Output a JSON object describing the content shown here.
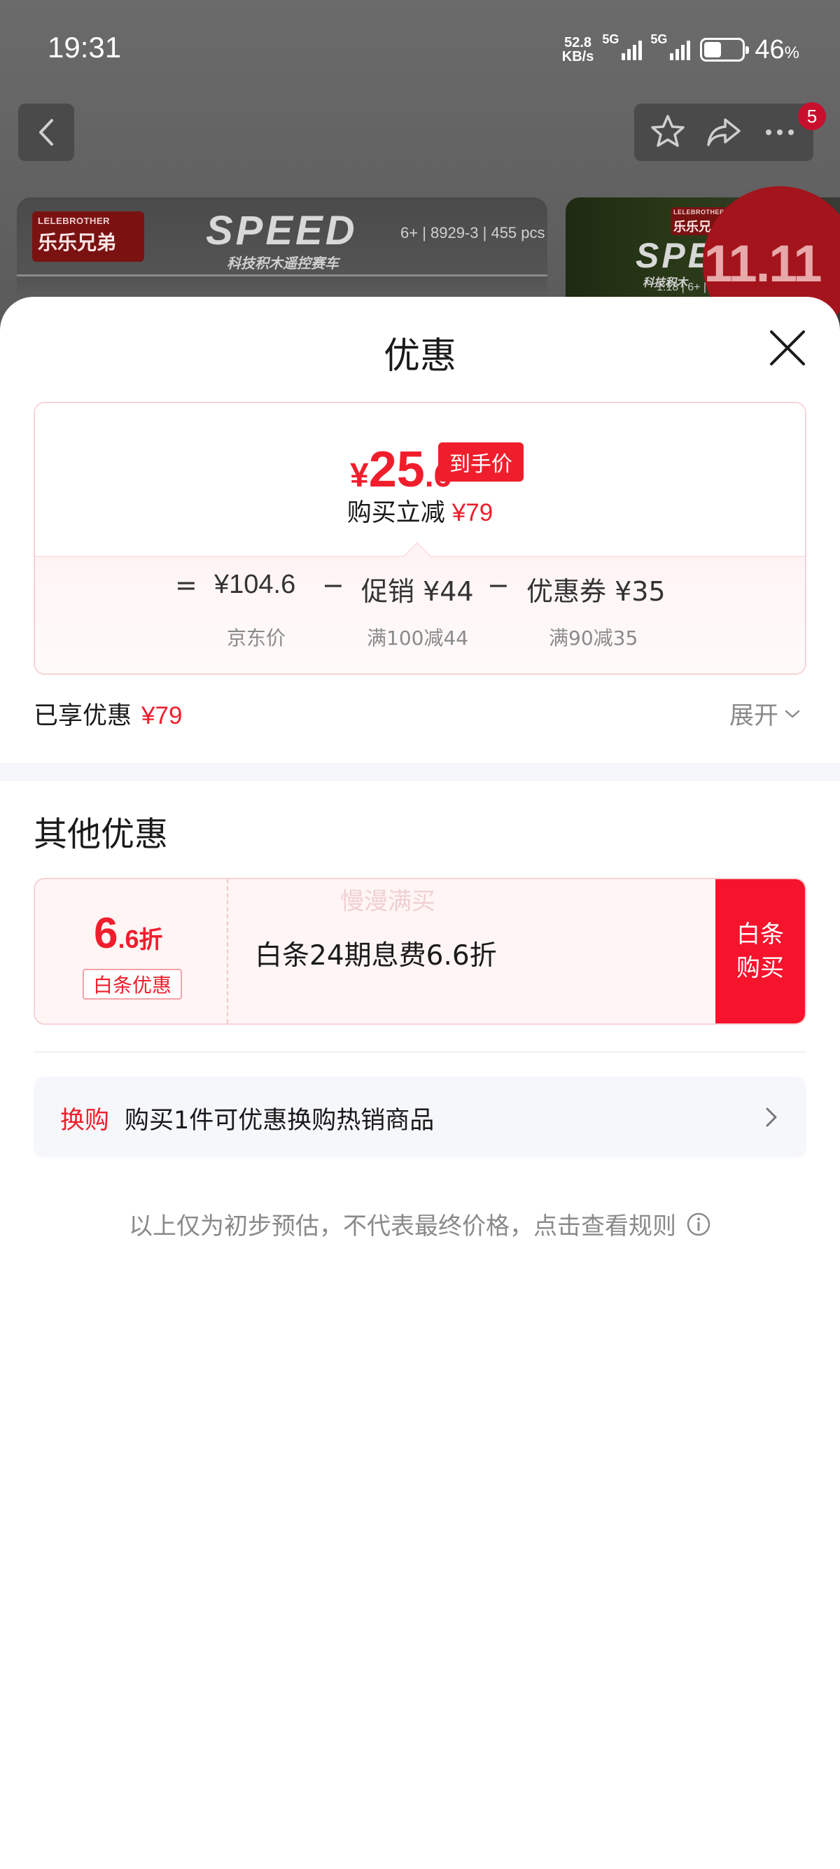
{
  "status_bar": {
    "time": "19:31",
    "net_speed_value": "52.8",
    "net_speed_unit": "KB/s",
    "signal1_label": "5G",
    "signal2_label": "5G",
    "battery_level": "46",
    "battery_unit": "%",
    "battery_fraction": 0.46
  },
  "header": {
    "cart_badge": "5"
  },
  "products": [
    {
      "brand_en": "LELEBROTHER",
      "brand_cn": "乐乐兄弟",
      "logo": "SPEED",
      "subtitle": "科技积木遥控赛车",
      "specs": "6+ | 8929-3 | 455 pcs"
    },
    {
      "brand_en": "LELEBROTHER",
      "brand_cn": "乐乐兄",
      "logo": "SPE",
      "subtitle": "科技积木",
      "specs": "1:18 | 6+ | 5"
    }
  ],
  "promo_badge": "11.11",
  "sheet": {
    "title": "优惠",
    "final_price": {
      "currency": "¥",
      "integer": "25",
      "decimal": ".6",
      "tag": "到手价"
    },
    "reduce_label": "购买立减",
    "reduce_amount": "¥79",
    "formula": {
      "equals": "=",
      "jd_price": "¥104.6",
      "minus1": "−",
      "promo": "促销 ¥44",
      "minus2": "−",
      "coupon": "优惠券 ¥35",
      "jd_price_label": "京东价",
      "promo_label": "满100减44",
      "coupon_label": "满90减35"
    },
    "enjoyed_label": "已享优惠",
    "enjoyed_amount": "¥79",
    "expand_label": "展开"
  },
  "other_offers": {
    "title": "其他优惠",
    "baitiao": {
      "discount_int": "6",
      "discount_dec": ".6",
      "discount_unit": "折",
      "tag": "白条优惠",
      "description": "白条24期息费6.6折",
      "watermark": "慢漫满买",
      "buy_line1": "白条",
      "buy_line2": "购买"
    },
    "swap": {
      "label": "换购",
      "text": "购买1件可优惠换购热销商品"
    }
  },
  "disclaimer": "以上仅为初步预估，不代表最终价格，点击查看规则",
  "colors": {
    "accent_red": "#f01e2c",
    "buy_button": "#f5142c",
    "muted_text": "#8a8a8a"
  }
}
